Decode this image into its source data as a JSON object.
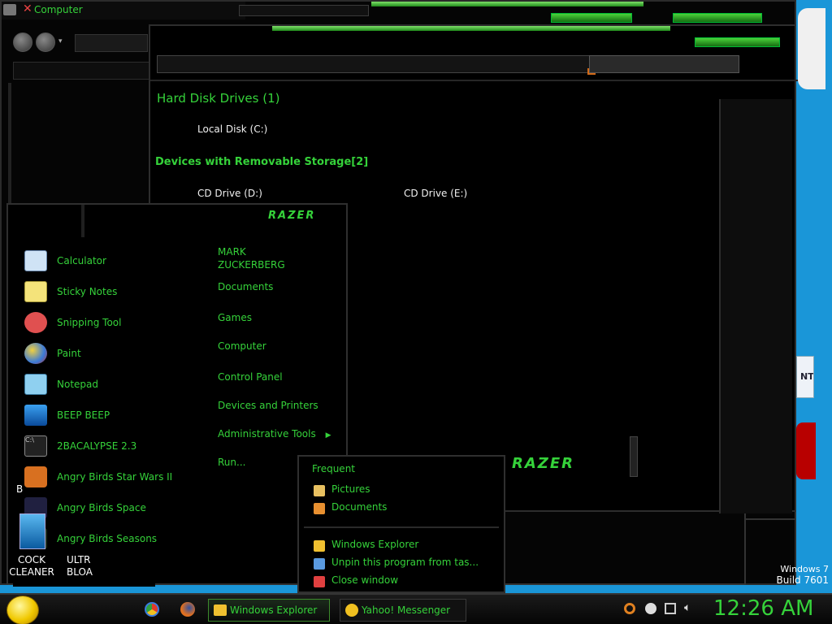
{
  "background_window": {
    "title": "Computer"
  },
  "main_window": {
    "section_hard_disks": "Hard Disk Drives (1)",
    "drive_c": "Local Disk (C:)",
    "section_removable": "Devices with Removable Storage[2]",
    "drive_d": "CD Drive (D:)",
    "drive_e": "CD Drive (E:)",
    "logo_text": "RAZER"
  },
  "start_menu": {
    "logo_text": "RAZER",
    "programs": [
      {
        "label": "Calculator",
        "icon": "calculator-icon"
      },
      {
        "label": "Sticky Notes",
        "icon": "sticky-notes-icon"
      },
      {
        "label": "Snipping Tool",
        "icon": "snipping-tool-icon"
      },
      {
        "label": "Paint",
        "icon": "paint-icon"
      },
      {
        "label": "Notepad",
        "icon": "notepad-icon"
      },
      {
        "label": "BEEP BEEP",
        "icon": "beep-icon"
      },
      {
        "label": "2BACALYPSE 2.3",
        "icon": "cmd-icon"
      },
      {
        "label": "Angry Birds Star Wars II",
        "icon": "angry-birds-icon"
      },
      {
        "label": "Angry Birds Space",
        "icon": "angry-birds-space-icon"
      },
      {
        "label": "Angry Birds Seasons",
        "icon": "angry-birds-seasons-icon"
      }
    ],
    "user_name_line1": "MARK",
    "user_name_line2": "ZUCKERBERG",
    "right_items": {
      "documents": "Documents",
      "games": "Games",
      "computer": "Computer",
      "control_panel": "Control Panel",
      "devices_printers": "Devices and Printers",
      "admin_tools": "Administrative Tools",
      "run": "Run..."
    }
  },
  "jump_list": {
    "frequent_header": "Frequent",
    "frequent": [
      "Pictures",
      "Documents"
    ],
    "tasks": [
      "Windows Explorer",
      "Unpin this program from tas...",
      "Close window"
    ]
  },
  "desktop": {
    "icon1_label_line1": "COCK",
    "icon1_label_line2": "CLEANER",
    "icon2_label_line1": "ULTR",
    "icon2_label_line2": "BLOA",
    "partial_letter": "B",
    "os_name": "Windows 7",
    "os_build": "Build 7601",
    "side_text": "NT"
  },
  "taskbar": {
    "windows_explorer": "Windows Explorer",
    "yahoo_messenger": "Yahoo! Messenger",
    "clock": "12:26 AM"
  },
  "colors": {
    "accent_green": "#35d23a",
    "desktop_blue": "#1a96d8",
    "window_black": "#000000"
  }
}
